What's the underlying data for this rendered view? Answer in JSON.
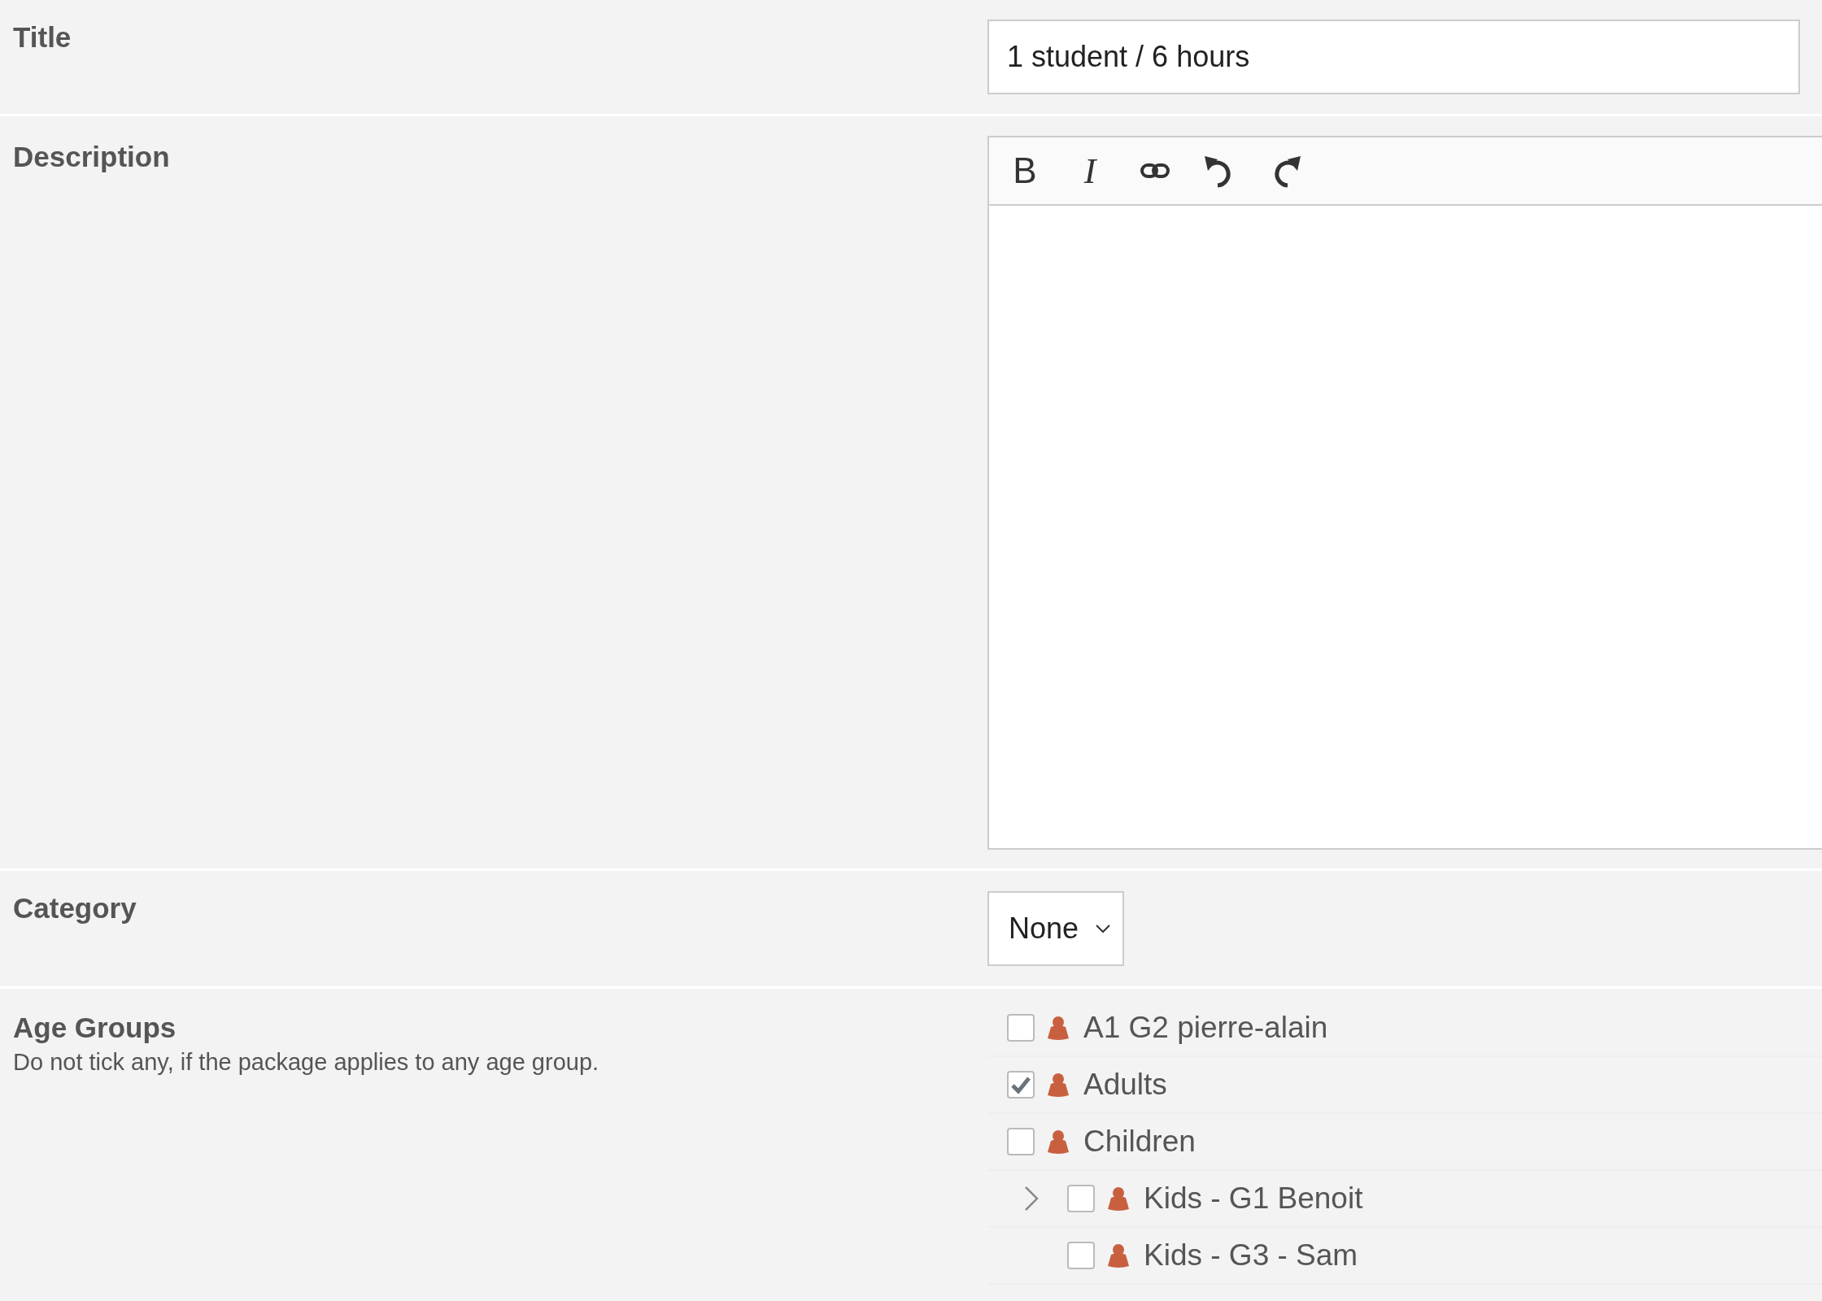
{
  "form": {
    "title": {
      "label": "Title",
      "value": "1 student / 6 hours"
    },
    "description": {
      "label": "Description",
      "toolbar": [
        {
          "kind": "bold",
          "glyph": "B"
        },
        {
          "kind": "italic",
          "glyph": "I"
        },
        {
          "kind": "link"
        },
        {
          "kind": "undo"
        },
        {
          "kind": "redo"
        }
      ]
    },
    "category": {
      "label": "Category",
      "value": "None"
    },
    "age_groups": {
      "label": "Age Groups",
      "hint": "Do not tick any, if the package applies to any age group.",
      "items": [
        {
          "label": "A1 G2 pierre-alain",
          "checked": false
        },
        {
          "label": "Adults",
          "checked": true
        },
        {
          "label": "Children",
          "checked": false,
          "children": [
            {
              "label": "Kids - G1 Benoit",
              "checked": false,
              "expanded": false
            },
            {
              "label": "Kids - G3 - Sam",
              "checked": false
            }
          ]
        }
      ]
    }
  }
}
